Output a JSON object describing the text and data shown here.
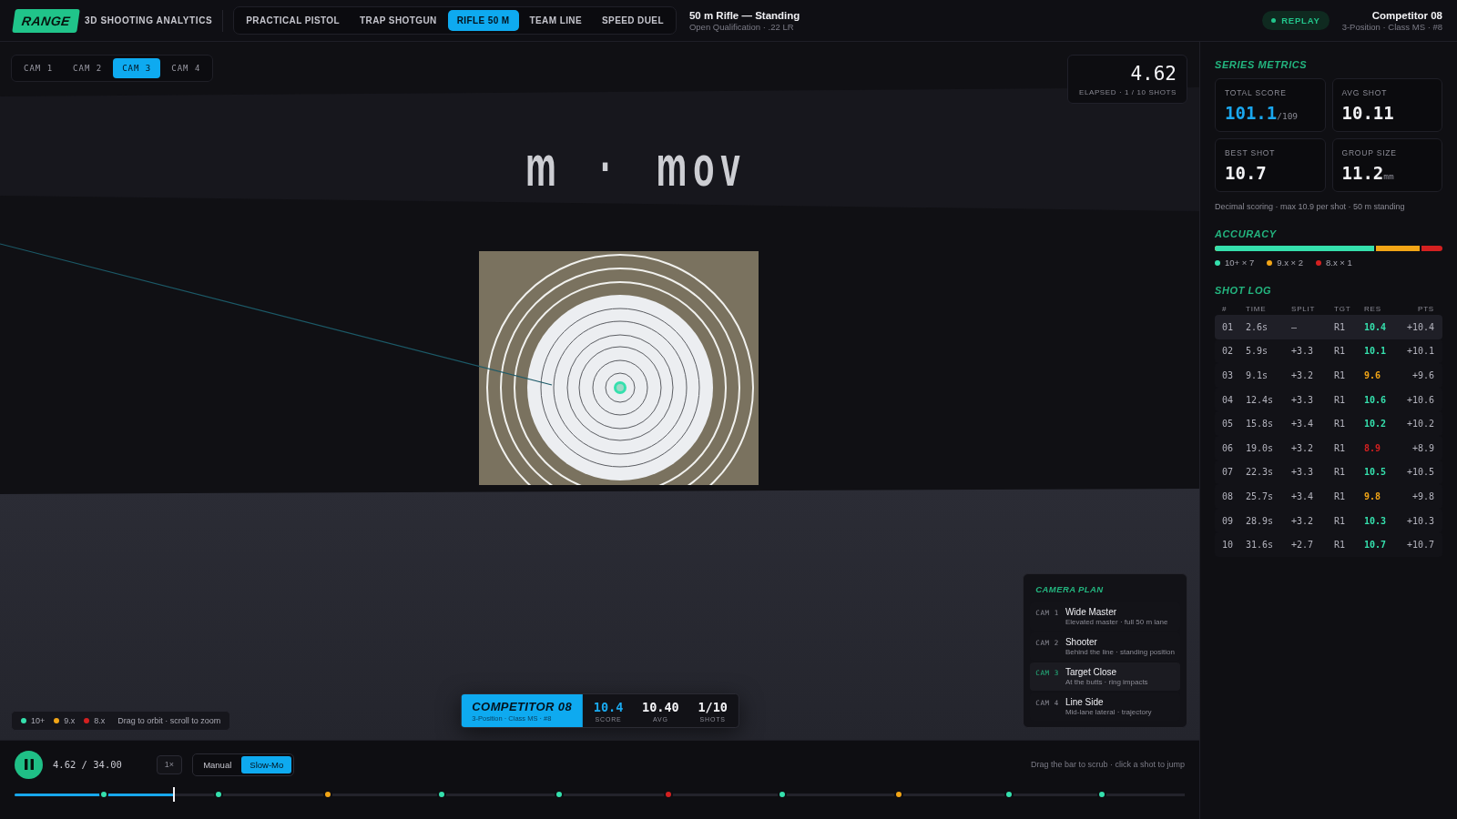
{
  "app": {
    "logo": "RANGE",
    "name": "3D SHOOTING ANALYTICS"
  },
  "disciplines": [
    {
      "label": "PRACTICAL PISTOL",
      "selected": false
    },
    {
      "label": "TRAP SHOTGUN",
      "selected": false
    },
    {
      "label": "RIFLE 50 M",
      "selected": true
    },
    {
      "label": "TEAM LINE",
      "selected": false
    },
    {
      "label": "SPEED DUEL",
      "selected": false
    }
  ],
  "event": {
    "title": "50 m Rifle — Standing",
    "subtitle": "Open Qualification · .22 LR"
  },
  "mode_badge": {
    "label": "REPLAY"
  },
  "competitor": {
    "name": "Competitor 08",
    "details": "3-Position · Class MS · #8"
  },
  "viewport": {
    "cameras": [
      {
        "label": "CAM 1",
        "selected": false
      },
      {
        "label": "CAM 2",
        "selected": false
      },
      {
        "label": "CAM 3",
        "selected": true
      },
      {
        "label": "CAM 4",
        "selected": false
      }
    ],
    "elapsed": {
      "value": "4.62",
      "caption": "ELAPSED · 1 / 10 SHOTS"
    },
    "scene_sign": "m · mov",
    "legend": {
      "items": [
        {
          "label": "10+",
          "color": "#35e0ad"
        },
        {
          "label": "9.x",
          "color": "#f2a516"
        },
        {
          "label": "8.x",
          "color": "#d42020"
        }
      ],
      "hint": "Drag to orbit · scroll to zoom"
    },
    "hud": {
      "name": "COMPETITOR 08",
      "details": "3-Position · Class MS · #8",
      "stats": [
        {
          "value": "10.4",
          "label": "SCORE",
          "highlighted": true
        },
        {
          "value": "10.40",
          "label": "AVG",
          "highlighted": false
        },
        {
          "value": "1/10",
          "label": "SHOTS",
          "highlighted": false
        }
      ]
    },
    "camera_plan": {
      "title": "CAMERA PLAN",
      "items": [
        {
          "cam": "CAM 1",
          "name": "Wide Master",
          "description": "Elevated master · full 50 m lane",
          "selected": false
        },
        {
          "cam": "CAM 2",
          "name": "Shooter",
          "description": "Behind the line · standing position",
          "selected": false
        },
        {
          "cam": "CAM 3",
          "name": "Target Close",
          "description": "At the butts · ring impacts",
          "selected": true
        },
        {
          "cam": "CAM 4",
          "name": "Line Side",
          "description": "Mid-lane lateral · trajectory",
          "selected": false
        }
      ]
    }
  },
  "playback": {
    "playing": true,
    "time": "4.62 / 34.00",
    "speed": "1×",
    "modes": [
      {
        "label": "Manual",
        "selected": false
      },
      {
        "label": "Slow-Mo",
        "selected": true
      }
    ],
    "hint": "Drag the bar to scrub · click a shot to jump",
    "timeline": {
      "level": 0.136,
      "markers": [
        {
          "level": 0.076,
          "color": "#35e0ad"
        },
        {
          "level": 0.174,
          "color": "#35e0ad"
        },
        {
          "level": 0.268,
          "color": "#f2a516"
        },
        {
          "level": 0.365,
          "color": "#35e0ad"
        },
        {
          "level": 0.465,
          "color": "#35e0ad"
        },
        {
          "level": 0.559,
          "color": "#d42020"
        },
        {
          "level": 0.656,
          "color": "#35e0ad"
        },
        {
          "level": 0.756,
          "color": "#f2a516"
        },
        {
          "level": 0.85,
          "color": "#35e0ad"
        },
        {
          "level": 0.929,
          "color": "#35e0ad"
        }
      ]
    }
  },
  "metrics": {
    "title": "SERIES METRICS",
    "cards": [
      {
        "label": "TOTAL SCORE",
        "value": "101.1",
        "unit": "/109",
        "highlighted": true
      },
      {
        "label": "AVG SHOT",
        "value": "10.11",
        "highlighted": false
      },
      {
        "label": "BEST SHOT",
        "value": "10.7",
        "highlighted": false
      },
      {
        "label": "GROUP SIZE",
        "value": "11.2",
        "unit": "mm",
        "highlighted": false
      }
    ],
    "note": "Decimal scoring · max 10.9 per shot · 50 m standing"
  },
  "accuracy": {
    "title": "ACCURACY",
    "bar": {
      "color": "#d42020",
      "segments": [
        {
          "level": 0.7,
          "color": "#35e0ad"
        },
        {
          "level": 0.9,
          "color": "#f2a516"
        }
      ]
    },
    "legend": [
      {
        "label": "10+ × 7",
        "color": "#35e0ad"
      },
      {
        "label": "9.x × 2",
        "color": "#f2a516"
      },
      {
        "label": "8.x × 1",
        "color": "#d42020"
      }
    ]
  },
  "shot_log": {
    "title": "SHOT LOG",
    "columns": [
      "#",
      "TIME",
      "SPLIT",
      "TGT",
      "RES",
      "PTS"
    ],
    "rows": [
      {
        "number": "01",
        "time": "2.6s",
        "split": "—",
        "target": "R1",
        "result": "10.4",
        "points": "+10.4",
        "color": "#35e0ad",
        "selected": true
      },
      {
        "number": "02",
        "time": "5.9s",
        "split": "+3.3",
        "target": "R1",
        "result": "10.1",
        "points": "+10.1",
        "color": "#35e0ad",
        "selected": false
      },
      {
        "number": "03",
        "time": "9.1s",
        "split": "+3.2",
        "target": "R1",
        "result": "9.6",
        "points": "+9.6",
        "color": "#f2a516",
        "selected": false
      },
      {
        "number": "04",
        "time": "12.4s",
        "split": "+3.3",
        "target": "R1",
        "result": "10.6",
        "points": "+10.6",
        "color": "#35e0ad",
        "selected": false
      },
      {
        "number": "05",
        "time": "15.8s",
        "split": "+3.4",
        "target": "R1",
        "result": "10.2",
        "points": "+10.2",
        "color": "#35e0ad",
        "selected": false
      },
      {
        "number": "06",
        "time": "19.0s",
        "split": "+3.2",
        "target": "R1",
        "result": "8.9",
        "points": "+8.9",
        "color": "#d42020",
        "selected": false
      },
      {
        "number": "07",
        "time": "22.3s",
        "split": "+3.3",
        "target": "R1",
        "result": "10.5",
        "points": "+10.5",
        "color": "#35e0ad",
        "selected": false
      },
      {
        "number": "08",
        "time": "25.7s",
        "split": "+3.4",
        "target": "R1",
        "result": "9.8",
        "points": "+9.8",
        "color": "#f2a516",
        "selected": false
      },
      {
        "number": "09",
        "time": "28.9s",
        "split": "+3.2",
        "target": "R1",
        "result": "10.3",
        "points": "+10.3",
        "color": "#35e0ad",
        "selected": false
      },
      {
        "number": "10",
        "time": "31.6s",
        "split": "+2.7",
        "target": "R1",
        "result": "10.7",
        "points": "+10.7",
        "color": "#35e0ad",
        "selected": false
      }
    ]
  }
}
